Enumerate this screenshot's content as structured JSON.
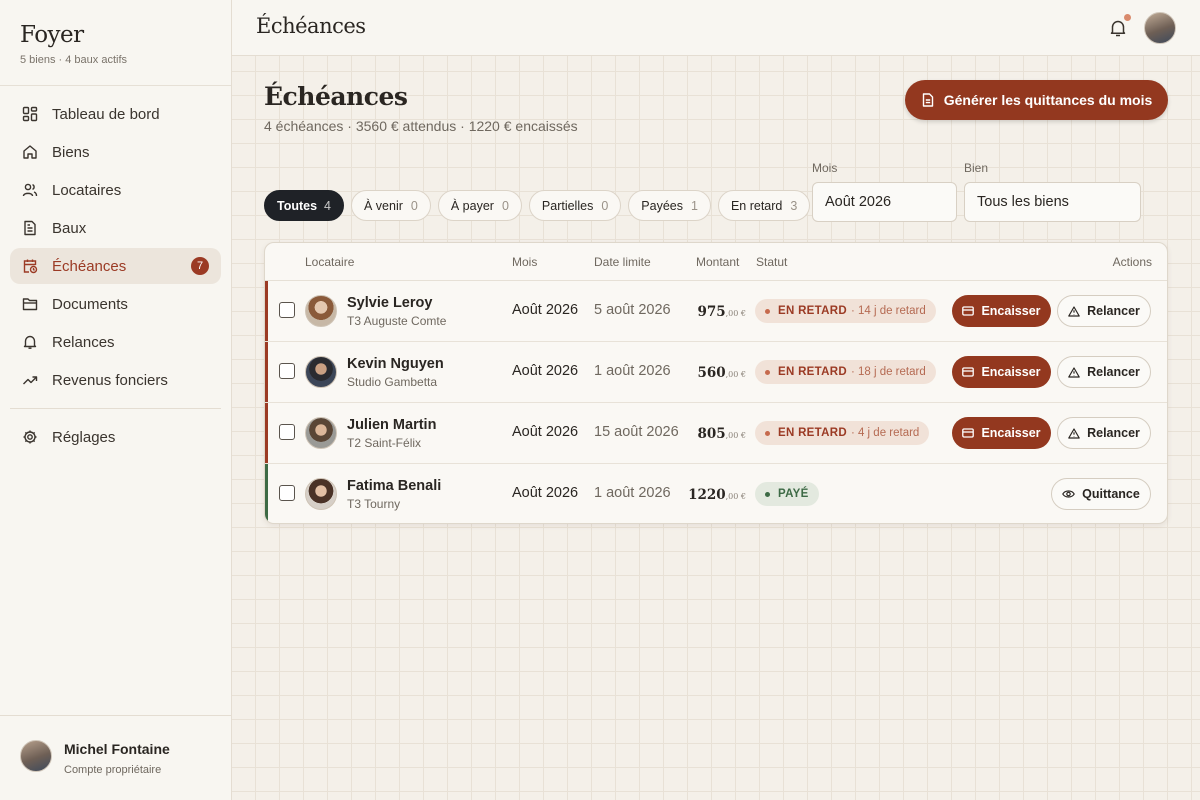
{
  "brand": {
    "name": "Foyer",
    "subtitle": "5 biens · 4 baux actifs"
  },
  "nav": [
    {
      "label": "Tableau de bord",
      "icon": "dashboard-icon"
    },
    {
      "label": "Biens",
      "icon": "home-icon"
    },
    {
      "label": "Locataires",
      "icon": "users-icon"
    },
    {
      "label": "Baux",
      "icon": "document-icon"
    },
    {
      "label": "Échéances",
      "icon": "calendar-clock-icon",
      "active": true,
      "count": "7"
    },
    {
      "label": "Documents",
      "icon": "folder-icon"
    },
    {
      "label": "Relances",
      "icon": "bell-icon"
    },
    {
      "label": "Revenus fonciers",
      "icon": "trending-up-icon"
    }
  ],
  "nav_settings": {
    "label": "Réglages",
    "icon": "gear-icon"
  },
  "user": {
    "name": "Michel Fontaine",
    "role": "Compte propriétaire"
  },
  "topbar": {
    "title": "Échéances"
  },
  "page": {
    "title": "Échéances",
    "subtitle": "4 échéances · 3560 € attendus · 1220 € encaissés",
    "generate_button": "Générer les quittances du mois"
  },
  "chips": [
    {
      "label": "Toutes",
      "count": "4",
      "active": true
    },
    {
      "label": "À venir",
      "count": "0"
    },
    {
      "label": "À payer",
      "count": "0"
    },
    {
      "label": "Partielles",
      "count": "0"
    },
    {
      "label": "Payées",
      "count": "1"
    },
    {
      "label": "En retard",
      "count": "3"
    }
  ],
  "filters": {
    "month_label": "Mois",
    "month_value": "Août 2026",
    "property_label": "Bien",
    "property_value": "Tous les biens"
  },
  "table": {
    "headers": {
      "tenant": "Locataire",
      "month": "Mois",
      "due": "Date limite",
      "amount": "Montant",
      "status": "Statut",
      "actions": "Actions"
    },
    "rows": [
      {
        "name": "Sylvie Leroy",
        "property": "T3 Auguste Comte",
        "month": "Août 2026",
        "due": "5 août 2026",
        "amount": "975",
        "decimals": ",00 €",
        "status": "EN RETARD",
        "status_extra": "· 14 j de retard",
        "cash": "Encaisser",
        "remind": "Relancer"
      },
      {
        "name": "Kevin Nguyen",
        "property": "Studio Gambetta",
        "month": "Août 2026",
        "due": "1 août 2026",
        "amount": "560",
        "decimals": ",00 €",
        "status": "EN RETARD",
        "status_extra": "· 18 j de retard",
        "cash": "Encaisser",
        "remind": "Relancer"
      },
      {
        "name": "Julien Martin",
        "property": "T2 Saint-Félix",
        "month": "Août 2026",
        "due": "15 août 2026",
        "amount": "805",
        "decimals": ",00 €",
        "status": "EN RETARD",
        "status_extra": "· 4 j de retard",
        "cash": "Encaisser",
        "remind": "Relancer"
      },
      {
        "name": "Fatima Benali",
        "property": "T3 Tourny",
        "month": "Août 2026",
        "due": "1 août 2026",
        "amount": "1220",
        "decimals": ",00 €",
        "status": "PAYÉ",
        "receipt": "Quittance"
      }
    ]
  },
  "colors": {
    "accent": "#93381f",
    "late_bar": "#9b3a24",
    "paid_bar": "#3d6a45",
    "dark_chip": "#1f2227"
  }
}
